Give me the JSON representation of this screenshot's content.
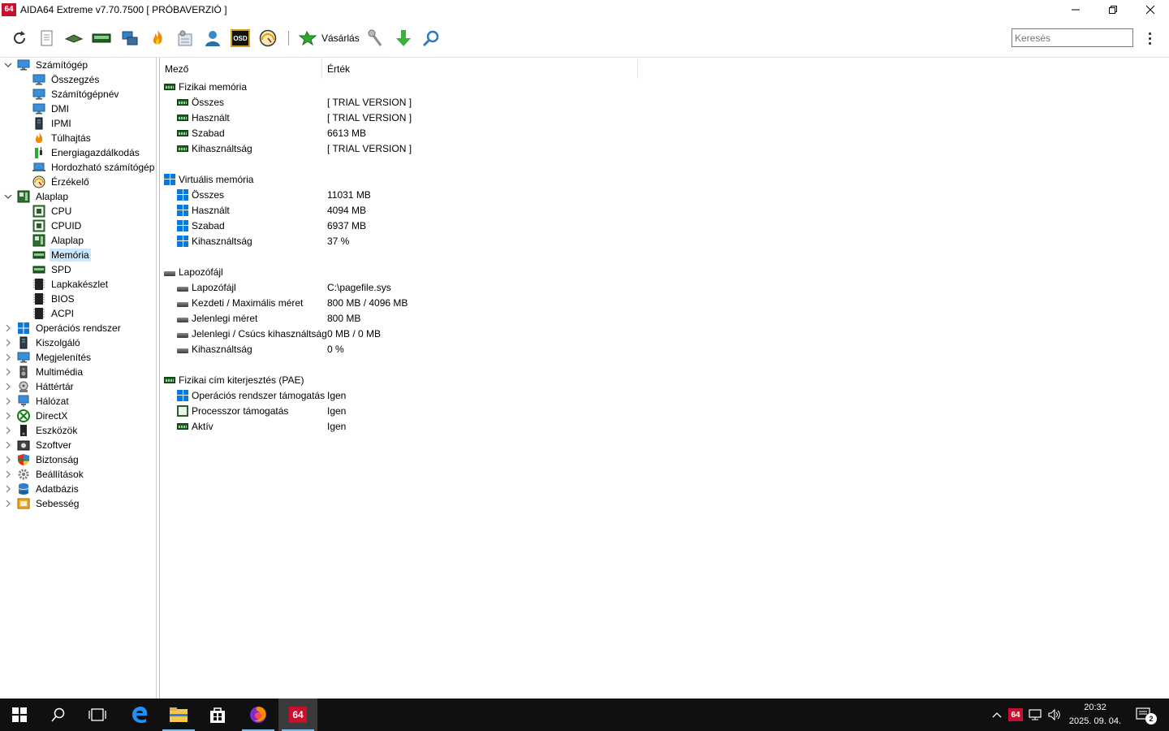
{
  "window": {
    "logo": "64",
    "title": "AIDA64 Extreme v7.70.7500  [ PRÓBAVERZIÓ ]"
  },
  "toolbar": {
    "icons": [
      "refresh-icon",
      "report-icon",
      "memory-module-icon",
      "ram-icon",
      "network-icon",
      "flame-icon",
      "benchmark-icon",
      "user-icon",
      "osd-icon",
      "gauge-icon"
    ],
    "osd_label": "OSD",
    "buy_label": "Vásárlás",
    "tools": [
      "wrench-icon",
      "download-icon",
      "search-icon"
    ],
    "search_placeholder": "Keresés"
  },
  "sidebar": {
    "items": [
      {
        "label": "Számítógép",
        "level": 0,
        "expanded": true,
        "icon": "computer-icon"
      },
      {
        "label": "Összegzés",
        "level": 1,
        "icon": "monitor-icon"
      },
      {
        "label": "Számítógépnév",
        "level": 1,
        "icon": "monitor-icon"
      },
      {
        "label": "DMI",
        "level": 1,
        "icon": "monitor-icon"
      },
      {
        "label": "IPMI",
        "level": 1,
        "icon": "server-icon"
      },
      {
        "label": "Túlhajtás",
        "level": 1,
        "icon": "flame-icon"
      },
      {
        "label": "Energiagazdálkodás",
        "level": 1,
        "icon": "battery-icon"
      },
      {
        "label": "Hordozható számítógép",
        "level": 1,
        "icon": "laptop-icon"
      },
      {
        "label": "Érzékelő",
        "level": 1,
        "icon": "gauge-icon"
      },
      {
        "label": "Alaplap",
        "level": 0,
        "expanded": true,
        "icon": "motherboard-icon"
      },
      {
        "label": "CPU",
        "level": 1,
        "icon": "cpu-icon"
      },
      {
        "label": "CPUID",
        "level": 1,
        "icon": "cpu-icon"
      },
      {
        "label": "Alaplap",
        "level": 1,
        "icon": "motherboard-icon"
      },
      {
        "label": "Memória",
        "level": 1,
        "icon": "ram-icon",
        "selected": true
      },
      {
        "label": "SPD",
        "level": 1,
        "icon": "ram-icon"
      },
      {
        "label": "Lapkakészlet",
        "level": 1,
        "icon": "chipset-icon"
      },
      {
        "label": "BIOS",
        "level": 1,
        "icon": "chipset-icon"
      },
      {
        "label": "ACPI",
        "level": 1,
        "icon": "chipset-icon"
      },
      {
        "label": "Operációs rendszer",
        "level": 0,
        "expanded": false,
        "icon": "windows-icon"
      },
      {
        "label": "Kiszolgáló",
        "level": 0,
        "expanded": false,
        "icon": "server-icon"
      },
      {
        "label": "Megjelenítés",
        "level": 0,
        "expanded": false,
        "icon": "monitor-icon"
      },
      {
        "label": "Multimédia",
        "level": 0,
        "expanded": false,
        "icon": "speaker-icon"
      },
      {
        "label": "Háttértár",
        "level": 0,
        "expanded": false,
        "icon": "storage-icon"
      },
      {
        "label": "Hálózat",
        "level": 0,
        "expanded": false,
        "icon": "network-icon"
      },
      {
        "label": "DirectX",
        "level": 0,
        "expanded": false,
        "icon": "xbox-icon"
      },
      {
        "label": "Eszközök",
        "level": 0,
        "expanded": false,
        "icon": "device-icon"
      },
      {
        "label": "Szoftver",
        "level": 0,
        "expanded": false,
        "icon": "software-icon"
      },
      {
        "label": "Biztonság",
        "level": 0,
        "expanded": false,
        "icon": "shield-icon"
      },
      {
        "label": "Beállítások",
        "level": 0,
        "expanded": false,
        "icon": "settings-icon"
      },
      {
        "label": "Adatbázis",
        "level": 0,
        "expanded": false,
        "icon": "database-icon"
      },
      {
        "label": "Sebesség",
        "level": 0,
        "expanded": false,
        "icon": "benchmark-icon"
      }
    ]
  },
  "table": {
    "columns": [
      "Mező",
      "Érték"
    ],
    "rows": [
      {
        "type": "group",
        "icon": "ram",
        "field": "Fizikai memória",
        "value": ""
      },
      {
        "type": "item",
        "icon": "ram",
        "field": "Összes",
        "value": "[ TRIAL VERSION ]"
      },
      {
        "type": "item",
        "icon": "ram",
        "field": "Használt",
        "value": "[ TRIAL VERSION ]"
      },
      {
        "type": "item",
        "icon": "ram",
        "field": "Szabad",
        "value": "6613 MB"
      },
      {
        "type": "item",
        "icon": "ram",
        "field": "Kihasználtság",
        "value": "[ TRIAL VERSION ]"
      },
      {
        "type": "blank"
      },
      {
        "type": "group",
        "icon": "windows",
        "field": "Virtuális memória",
        "value": ""
      },
      {
        "type": "item",
        "icon": "windows",
        "field": "Összes",
        "value": "11031 MB"
      },
      {
        "type": "item",
        "icon": "windows",
        "field": "Használt",
        "value": "4094 MB"
      },
      {
        "type": "item",
        "icon": "windows",
        "field": "Szabad",
        "value": "6937 MB"
      },
      {
        "type": "item",
        "icon": "windows",
        "field": "Kihasználtság",
        "value": "37 %"
      },
      {
        "type": "blank"
      },
      {
        "type": "group",
        "icon": "drive",
        "field": "Lapozófájl",
        "value": ""
      },
      {
        "type": "item",
        "icon": "drive",
        "field": "Lapozófájl",
        "value": "C:\\pagefile.sys"
      },
      {
        "type": "item",
        "icon": "drive",
        "field": "Kezdeti / Maximális méret",
        "value": "800 MB / 4096 MB"
      },
      {
        "type": "item",
        "icon": "drive",
        "field": "Jelenlegi méret",
        "value": "800 MB"
      },
      {
        "type": "item",
        "icon": "drive",
        "field": "Jelenlegi / Csúcs kihasználtság",
        "value": "0 MB / 0 MB"
      },
      {
        "type": "item",
        "icon": "drive",
        "field": "Kihasználtság",
        "value": "0 %"
      },
      {
        "type": "blank"
      },
      {
        "type": "group",
        "icon": "ram",
        "field": "Fizikai cím kiterjesztés (PAE)",
        "value": ""
      },
      {
        "type": "item",
        "icon": "windows",
        "field": "Operációs rendszer támogatás",
        "value": "Igen"
      },
      {
        "type": "item",
        "icon": "chip",
        "field": "Processzor támogatás",
        "value": "Igen"
      },
      {
        "type": "item",
        "icon": "ram",
        "field": "Aktív",
        "value": "Igen"
      }
    ]
  },
  "taskbar": {
    "apps": [
      "start-icon",
      "search-icon",
      "task-view-icon",
      "edge-icon",
      "file-explorer-icon",
      "store-icon",
      "firefox-icon",
      "aida64-icon"
    ],
    "aida_label": "64",
    "tray_aida_label": "64",
    "clock_time": "20:32",
    "clock_date": "2025. 09. 04.",
    "notification_count": "2"
  }
}
